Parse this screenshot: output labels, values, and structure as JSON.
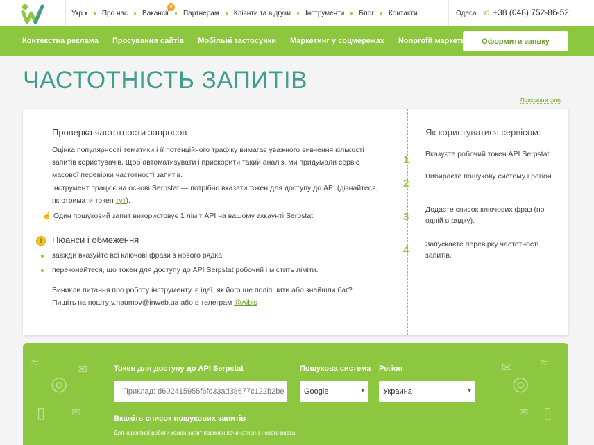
{
  "topbar": {
    "nav": [
      {
        "label": "Укр",
        "dropdown": true
      },
      {
        "label": "Про нас"
      },
      {
        "label": "Вакансії",
        "badge": "9"
      },
      {
        "label": "Партнерам"
      },
      {
        "label": "Клієнти та відгуки"
      },
      {
        "label": "Інструменти"
      },
      {
        "label": "Блог"
      },
      {
        "label": "Контакти"
      }
    ],
    "city": "Одеса",
    "phone": "+38 (048) 752-86-52"
  },
  "greennav": {
    "items": [
      "Контекстна реклама",
      "Просування сайтів",
      "Мобільні застосунки",
      "Маркетинг у соцмережах",
      "Nonprofit маркетинг"
    ],
    "order_button": "Оформити заявку"
  },
  "page_title": "ЧАСТОТНІСТЬ ЗАПИТІВ",
  "hide_link": "Приховати опис",
  "card": {
    "heading": "Проверка частотности запросов",
    "p1": "Оцінка популярності тематики і її потенційного трафіку вимагає уважного вивчення кількості запитів користувачів. Щоб автоматизувати і прискорити такий аналіз, ми придумали сервіс масової перевірки частотності запитів.",
    "p2_prefix": "Інструмент працює на основі Serpstat — потрібно вказати токен для доступу до API (дізнайтеся, як отримати токен ",
    "p2_link": "тут",
    "p2_suffix": ").",
    "p3": "Один пошуковий запит використовує 1 ліміт API на вашому аккаунті Serpstat.",
    "nuances_heading": "Нюанси і обмеження",
    "bullets": [
      "завжди вказуйте всі ключові фрази з нового рядка;",
      "переконайтеся, що токен для доступу до API Serpstat робочий і містить ліміти."
    ],
    "p4_prefix": "Виникли питання про роботу інструменту, є ідеї, як його ще поліпшити або знайшли баг? Пишіть на пошту v.naumov@inweb.ua або в телеграм ",
    "p4_link": "@Aibis",
    "right_heading": "Як користуватися сервісом:",
    "steps": [
      {
        "num": "1",
        "text": "Вказуєте робочий токен API Serpstat."
      },
      {
        "num": "2",
        "text": "Вибираєте пошукову систему і регіон."
      },
      {
        "num": "3",
        "text": "Додаєте список ключових фраз (по одній в рядку)."
      },
      {
        "num": "4",
        "text": "Запускаєте перевірку частотності запитів."
      }
    ]
  },
  "form": {
    "token_label": "Токен для доступу до API Serpstat",
    "token_placeholder": "Приклад: d602415955f6fc33ad38677c122b2be",
    "engine_label": "Пошукова система",
    "engine_value": "Google",
    "region_label": "Регіон",
    "region_value": "Украина",
    "queries_label": "Вкажіть список пошукових запитів",
    "queries_note": "Для коректної роботи кожен запит повинен починатися з нового рядка"
  },
  "colors": {
    "accent": "#8dc63f",
    "title": "#3f9e8c",
    "badge": "#f5a623"
  }
}
